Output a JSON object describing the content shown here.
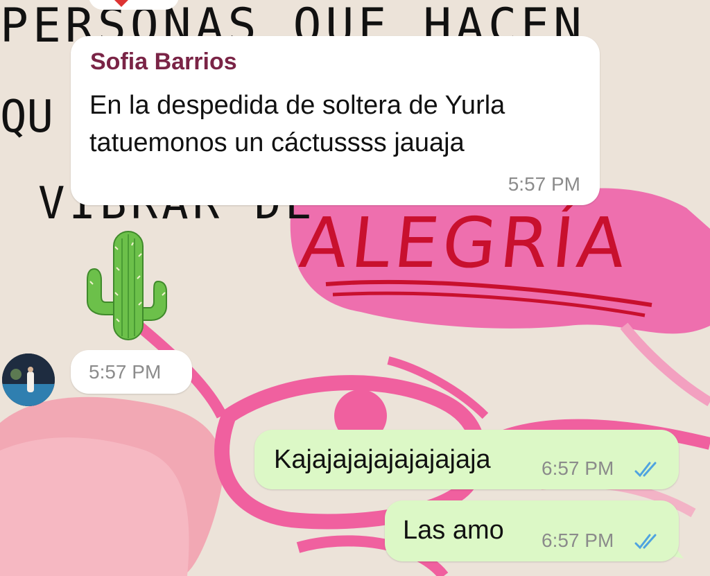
{
  "chat": {
    "wallpaper_text": {
      "line1": "PERSONAS QUE HACEN",
      "line2": "QU",
      "line3": "VIBRAR DE",
      "highlight": "ALEGRÍA"
    },
    "messages": [
      {
        "id": "m1",
        "direction": "incoming",
        "sender": "Sofia Barrios",
        "line1": "En la despedida de soltera de Yurla",
        "line2": "tatuemonos un cáctussss jauaja",
        "time": "5:57 PM"
      },
      {
        "id": "m2",
        "direction": "incoming",
        "sticker": "cactus-emoji",
        "time": "5:57 PM"
      },
      {
        "id": "m3",
        "direction": "outgoing",
        "text": "Kajajajajajajajajaja",
        "time": "6:57 PM",
        "status": "read-double-check"
      },
      {
        "id": "m4",
        "direction": "outgoing",
        "text": "Las amo",
        "time": "6:57 PM",
        "status": "read-double-check"
      }
    ]
  },
  "colors": {
    "incoming_bubble": "#ffffff",
    "outgoing_bubble": "#dcf8c6",
    "sender_name": "#7a2446",
    "timestamp": "#8b8b8b",
    "read_ticks": "#4fa3e0",
    "wallpaper_pink": "#ee6fae",
    "wallpaper_red": "#c8102e"
  }
}
